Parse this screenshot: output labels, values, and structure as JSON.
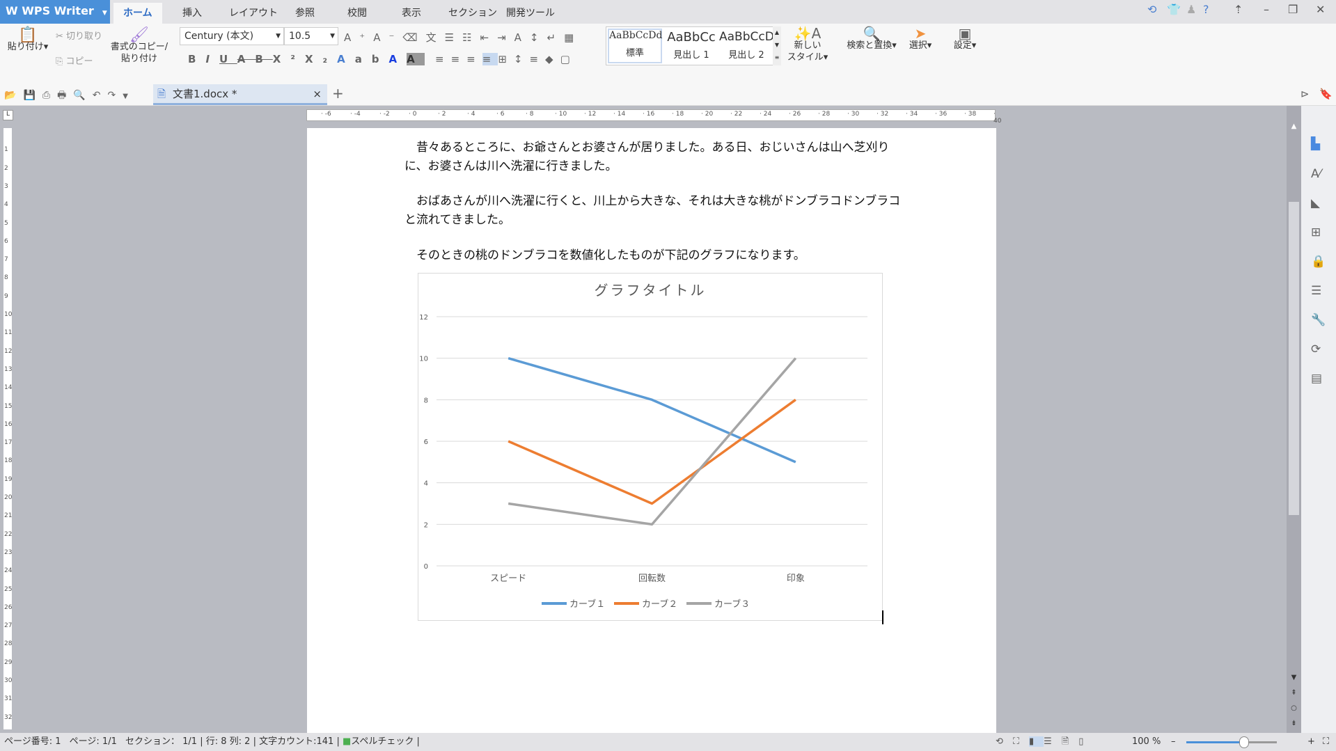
{
  "app": {
    "name": "WPS Writer"
  },
  "tabs": [
    "ホーム",
    "挿入",
    "レイアウト",
    "参照",
    "校閲",
    "表示",
    "セクション",
    "開発ツール"
  ],
  "ribbon": {
    "paste": "貼り付け",
    "cut": "切り取り",
    "copy": "コピー",
    "format_painter": "書式のコピー/\n貼り付け",
    "font": "Century (本文)",
    "size": "10.5",
    "styles": [
      {
        "preview": "AaBbCcDd",
        "name": "標準"
      },
      {
        "preview": "AaBbCc",
        "name": "見出し 1"
      },
      {
        "preview": "AaBbCcD",
        "name": "見出し 2"
      }
    ],
    "new_style": "新しい\nスタイル",
    "find_replace": "検索と置換",
    "select": "選択",
    "settings": "設定"
  },
  "document_tab": {
    "name": "文書1.docx *"
  },
  "document": {
    "paragraphs": [
      "　昔々あるところに、お爺さんとお婆さんが居りました。ある日、おじいさんは山へ芝刈りに、お婆さんは川へ洗濯に行きました。",
      "　おばあさんが川へ洗濯に行くと、川上から大きな、それは大きな桃がドンブラコドンブラコと流れてきました。",
      "　そのときの桃のドンブラコを数値化したものが下記のグラフになります。"
    ]
  },
  "chart_data": {
    "type": "line",
    "title": "グラフタイトル",
    "categories": [
      "スピード",
      "回転数",
      "印象"
    ],
    "ylim": [
      0,
      12
    ],
    "yticks": [
      0,
      2,
      4,
      6,
      8,
      10,
      12
    ],
    "grid": true,
    "legend": "bottom",
    "series": [
      {
        "name": "カーブ１",
        "values": [
          10,
          8,
          5
        ],
        "color": "#5b9bd5"
      },
      {
        "name": "カーブ２",
        "values": [
          6,
          3,
          8
        ],
        "color": "#ed7d31"
      },
      {
        "name": "カーブ３",
        "values": [
          3,
          2,
          10
        ],
        "color": "#a5a5a5"
      }
    ]
  },
  "status": {
    "page_no": "ページ番号: 1",
    "pages": "ページ: 1/1",
    "section": "セクション： 1/1",
    "row": "行: 8",
    "col": "列: 2",
    "word_count": "文字カウント:141",
    "spell": "スペルチェック",
    "zoom": "100 %",
    "zoom_level": 100
  },
  "colors": {
    "accent": "#4a90d9"
  }
}
